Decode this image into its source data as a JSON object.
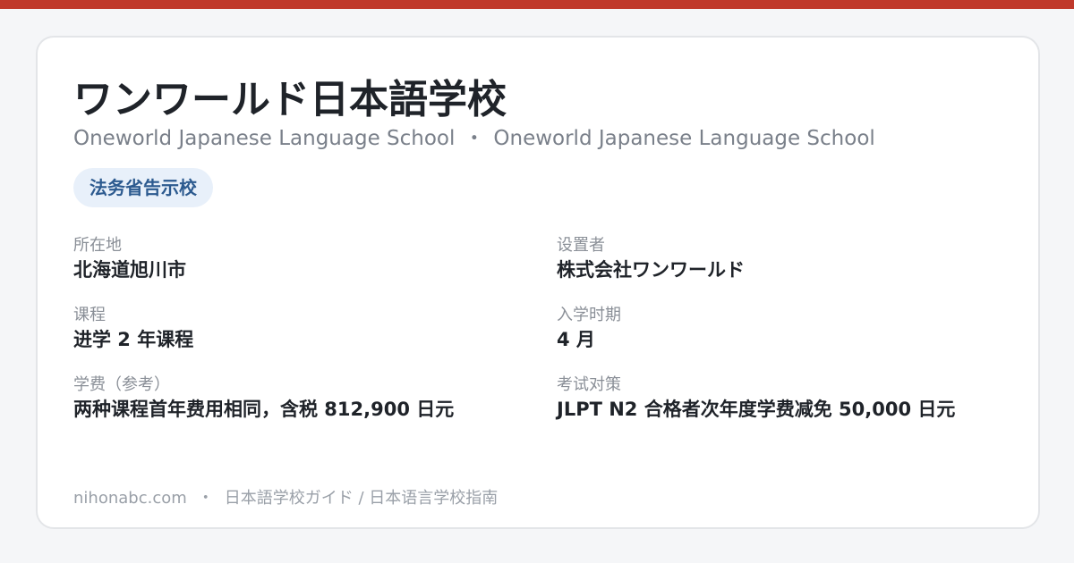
{
  "accent_color": "#c0392b",
  "school": {
    "name_ja": "ワンワールド日本語学校",
    "name_en": "Oneworld Japanese Language School",
    "name_en_2": "Oneworld Japanese Language School",
    "separator": "・",
    "badge": "法务省告示校"
  },
  "fields": {
    "location": {
      "label": "所在地",
      "value": "北海道旭川市"
    },
    "operator": {
      "label": "设置者",
      "value": "株式会社ワンワールド"
    },
    "course": {
      "label": "课程",
      "value": "进学 2 年课程"
    },
    "intake": {
      "label": "入学时期",
      "value": "4 月"
    },
    "tuition": {
      "label": "学费（参考）",
      "value": "两种课程首年费用相同，含税 812,900 日元"
    },
    "exam": {
      "label": "考试对策",
      "value": "JLPT N2 合格者次年度学费减免 50,000 日元"
    }
  },
  "footer": {
    "site": "nihonabc.com",
    "separator": "・",
    "guide": "日本語学校ガイド / 日本语言学校指南"
  }
}
